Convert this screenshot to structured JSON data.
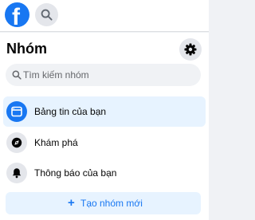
{
  "topbar": {
    "logo_letter": "f",
    "logo_icon": "facebook-logo-icon",
    "search_icon": "search-icon"
  },
  "panel": {
    "title": "Nhóm",
    "settings_icon": "gear-icon",
    "search": {
      "placeholder": "Tìm kiếm nhóm",
      "value": ""
    },
    "nav": [
      {
        "label": "Bảng tin của bạn",
        "icon": "feed-icon",
        "active": true
      },
      {
        "label": "Khám phá",
        "icon": "compass-icon",
        "active": false
      },
      {
        "label": "Thông báo của bạn",
        "icon": "bell-icon",
        "active": false
      }
    ],
    "create_button": {
      "plus": "+",
      "label": "Tạo nhóm mới"
    }
  },
  "colors": {
    "brand": "#1877f2",
    "active_bg": "#e7f3ff",
    "icon_bg": "#e4e6eb",
    "search_bg": "#f0f2f5",
    "text": "#050505",
    "secondary_text": "#65676b"
  }
}
